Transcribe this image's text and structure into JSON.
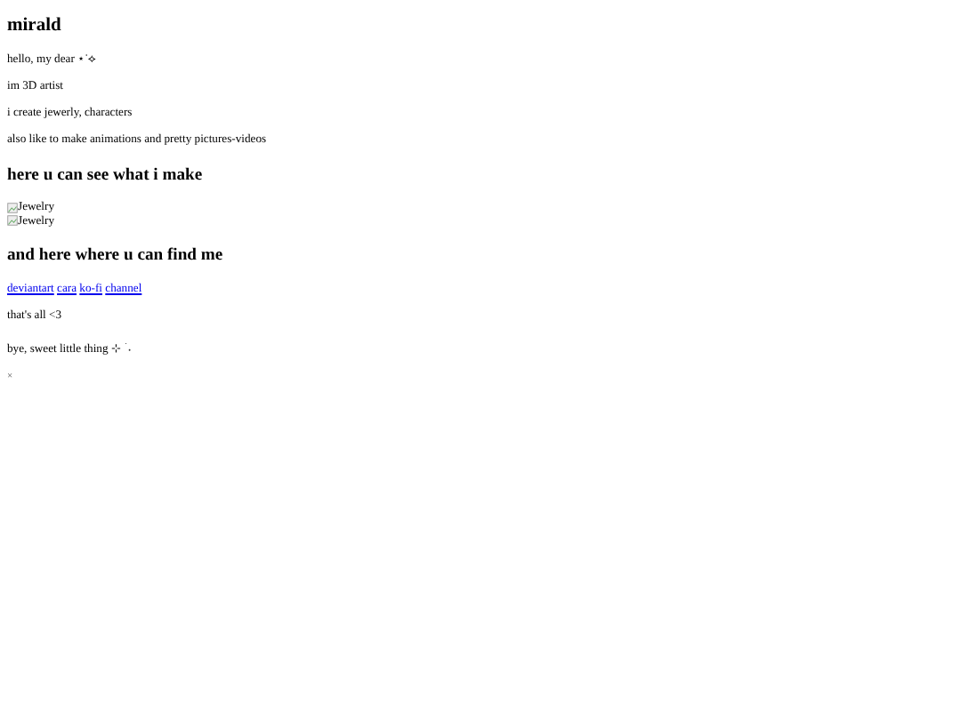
{
  "title": "mirald",
  "intro": [
    "hello, my dear ⋆˙⟡",
    "im 3D artist",
    "i create jewerly, characters",
    "also like to make animations and pretty pictures-videos"
  ],
  "gallery_heading": "here u can see what i make",
  "images": [
    {
      "alt": "Jewelry"
    },
    {
      "alt": "Jewelry"
    }
  ],
  "links_heading": "and here where u can find me",
  "links": [
    "deviantart",
    "cara",
    "ko-fi",
    "channel"
  ],
  "outro": [
    "that's all <3",
    "bye, sweet little thing ⊹ ࣪ ˖"
  ],
  "footer_mark": "×"
}
